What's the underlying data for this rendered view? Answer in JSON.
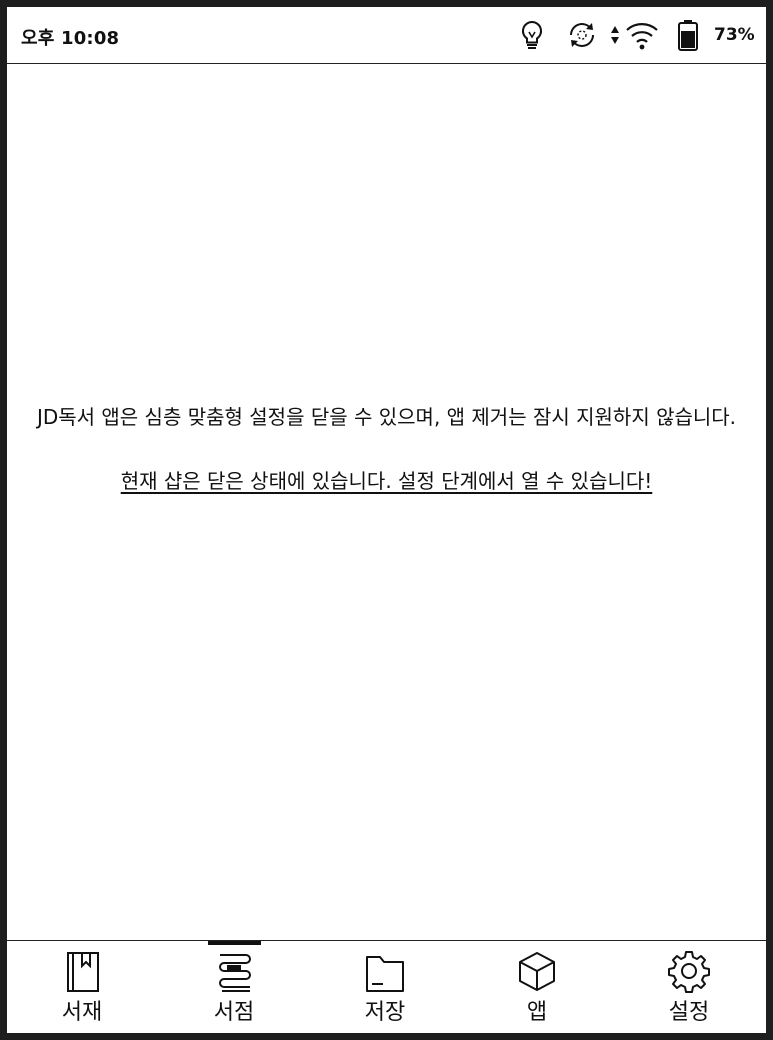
{
  "status_bar": {
    "time": "오후 10:08",
    "battery_percent": "73%",
    "battery_level": 0.73,
    "icons": [
      "lightbulb-icon",
      "sync-icon",
      "data-arrows-icon",
      "wifi-icon",
      "battery-icon"
    ]
  },
  "message": {
    "line1": "JD독서 앱은 심층 맞춤형 설정을 닫을 수 있으며, 앱 제거는 잠시 지원하지 않습니다.",
    "link": "현재 샵은 닫은 상태에 있습니다. 설정 단계에서 열 수 있습니다!"
  },
  "bottom_nav": {
    "active": "서점",
    "items": [
      {
        "label": "서재",
        "icon": "bookmark-book-icon"
      },
      {
        "label": "서점",
        "icon": "bookstore-icon"
      },
      {
        "label": "저장",
        "icon": "folder-icon"
      },
      {
        "label": "앱",
        "icon": "cube-icon"
      },
      {
        "label": "설정",
        "icon": "gear-icon"
      }
    ]
  }
}
